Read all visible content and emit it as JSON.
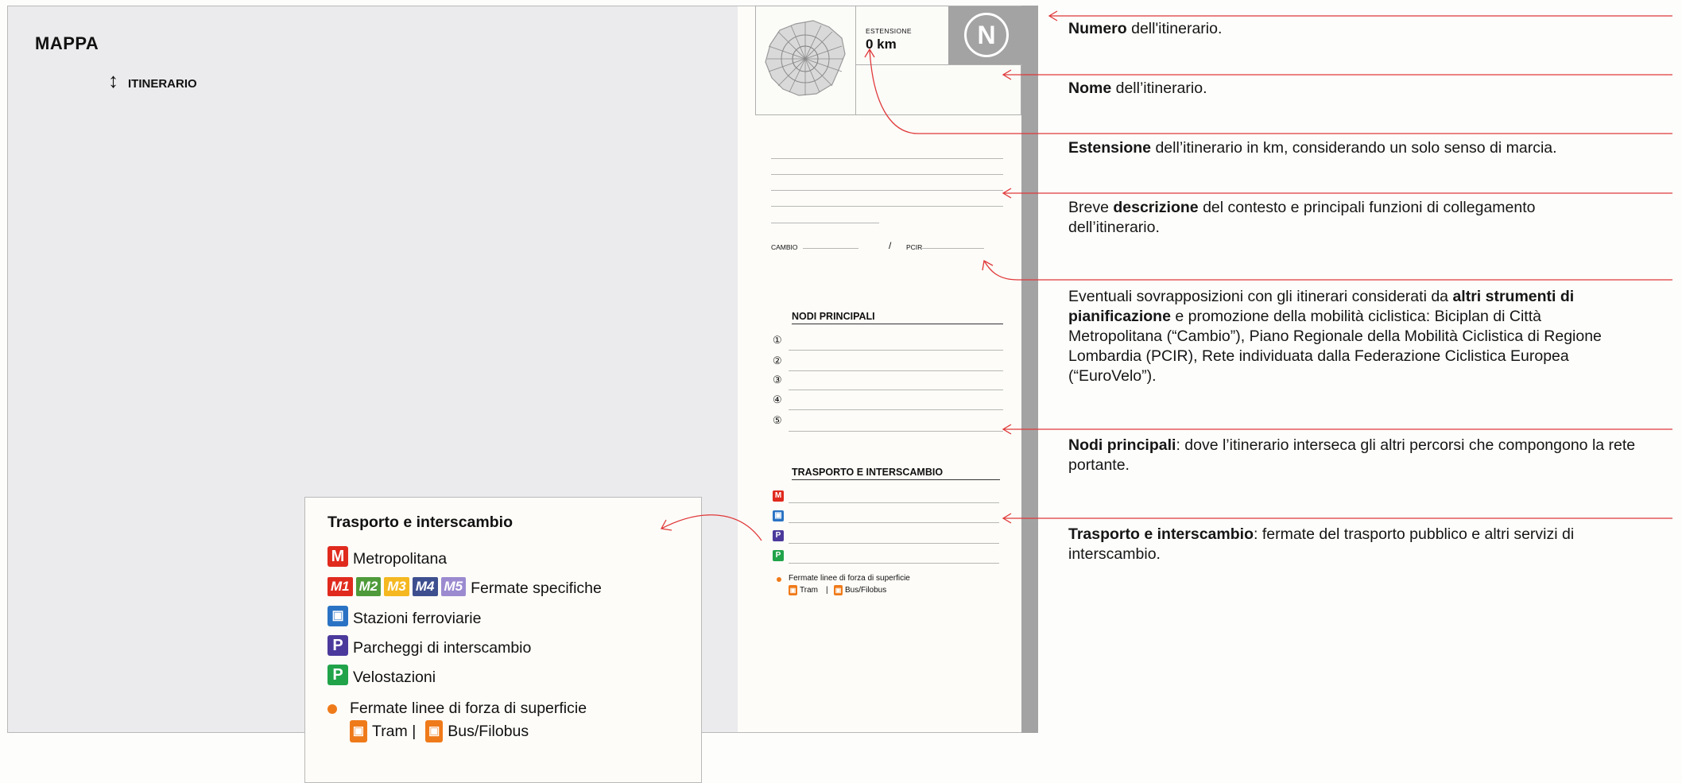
{
  "map": {
    "title": "MAPPA"
  },
  "sheet": {
    "est_label": "ESTENSIONE",
    "est_value": "0 km",
    "number": "N",
    "itinerary": "ITINERARIO",
    "cambio": "CAMBIO",
    "slash": "/",
    "pcir": "PCIR",
    "nodi_title": "NODI PRINCIPALI",
    "nodi_numbers": [
      "①",
      "②",
      "③",
      "④",
      "⑤"
    ],
    "trasporto_title": "TRASPORTO E INTERSCAMBIO",
    "icons": {
      "m": "M",
      "p": "P"
    },
    "fermate": "Fermate linee di forza di superficie",
    "tram": "Tram",
    "sep": "|",
    "bus": "Bus/Filobus"
  },
  "notes": [
    {
      "bold": "Numero",
      "text": " dell'itinerario."
    },
    {
      "bold": "Nome",
      "text": " dell’itinerario."
    },
    {
      "bold": "Estensione",
      "text": " dell’itinerario in km, considerando un solo senso di marcia."
    },
    {
      "pre": "Breve ",
      "bold": "descrizione",
      "text": " del contesto e principali funzioni di collegamento dell’itinerario."
    },
    {
      "pre": "Eventuali sovrapposizioni con gli itinerari considerati da ",
      "bold": "altri strumenti di pianificazione",
      "text": " e promozione della mobilità ciclistica: Biciplan di Città Metropolitana (“Cambio”), Piano Regionale della Mobilità Ciclistica di Regione Lombardia (PCIR), Rete individuata dalla Federazione Ciclistica Europea (“EuroVelo”)."
    },
    {
      "bold": "Nodi principali",
      "text": ": dove l’itinerario interseca gli altri percorsi che compongono la rete portante."
    },
    {
      "bold": "Trasporto e interscambio",
      "text": ": fermate del trasporto pubblico e altri servizi di interscambio."
    }
  ],
  "legend": {
    "title": "Trasporto e interscambio",
    "metro": "Metropolitana",
    "lines": [
      "M1",
      "M2",
      "M3",
      "M4",
      "M5"
    ],
    "specific": "Fermate specifiche",
    "rail": "Stazioni ferroviarie",
    "parking": "Parcheggi di interscambio",
    "bike": "Velostazioni",
    "surface": "Fermate linee di forza di superficie",
    "tram": "Tram |",
    "bus": "Bus/Filobus"
  },
  "colors": {
    "metro": "#e02a1e",
    "M1": "#e02a1e",
    "M2": "#4f9a3a",
    "M3": "#f5b821",
    "M4": "#3e4f8f",
    "M5": "#9b8ad0",
    "rail": "#2a73c4",
    "parking": "#4b3a9c",
    "bike": "#21a34a",
    "surface": "#ef7a1a",
    "arrow": "#e0393a"
  }
}
